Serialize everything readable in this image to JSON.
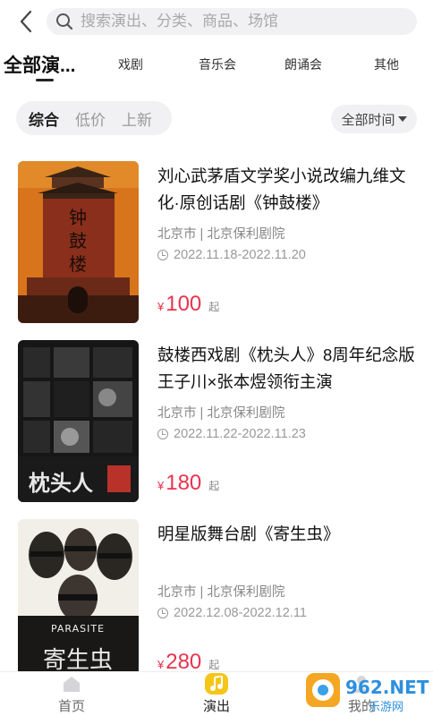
{
  "header": {
    "back_icon": "chevron-left-icon",
    "search_icon": "search-icon",
    "search_placeholder": "搜索演出、分类、商品、场馆"
  },
  "tabs": [
    {
      "label": "全部演...",
      "active": true
    },
    {
      "label": "戏剧",
      "active": false
    },
    {
      "label": "音乐会",
      "active": false
    },
    {
      "label": "朗诵会",
      "active": false
    },
    {
      "label": "其他",
      "active": false
    }
  ],
  "sort": {
    "options": [
      "综合",
      "低价",
      "上新"
    ],
    "active_index": 0,
    "time_filter": "全部时间"
  },
  "shows": [
    {
      "title": "刘心武茅盾文学奖小说改编九维文化·原创话剧《钟鼓楼》",
      "venue": "北京市 | 北京保利剧院",
      "dates": "2022.11.18-2022.11.20",
      "currency": "¥",
      "price": "100",
      "price_suffix": "起",
      "poster_text": "钟鼓楼"
    },
    {
      "title": "鼓楼西戏剧《枕头人》8周年纪念版王子川×张本煜领衔主演",
      "venue": "北京市 | 北京保利剧院",
      "dates": "2022.11.22-2022.11.23",
      "currency": "¥",
      "price": "180",
      "price_suffix": "起",
      "poster_text": "枕头人"
    },
    {
      "title": "明星版舞台剧《寄生虫》",
      "venue": "北京市 | 北京保利剧院",
      "dates": "2022.12.08-2022.12.11",
      "currency": "¥",
      "price": "280",
      "price_suffix": "起",
      "poster_text": "PARASITE",
      "poster_subtext": "寄生虫"
    }
  ],
  "bottom_nav": [
    {
      "label": "首页",
      "icon": "home-icon",
      "active": false
    },
    {
      "label": "演出",
      "icon": "music-note-icon",
      "active": true
    },
    {
      "label": "我的",
      "icon": "user-icon",
      "active": false
    }
  ],
  "watermark": {
    "text": "962.NET",
    "subtext": "乐游网"
  },
  "colors": {
    "price": "#e8344e",
    "accent_yellow": "#f5c518",
    "tab_bg": "#f1f1f3"
  }
}
